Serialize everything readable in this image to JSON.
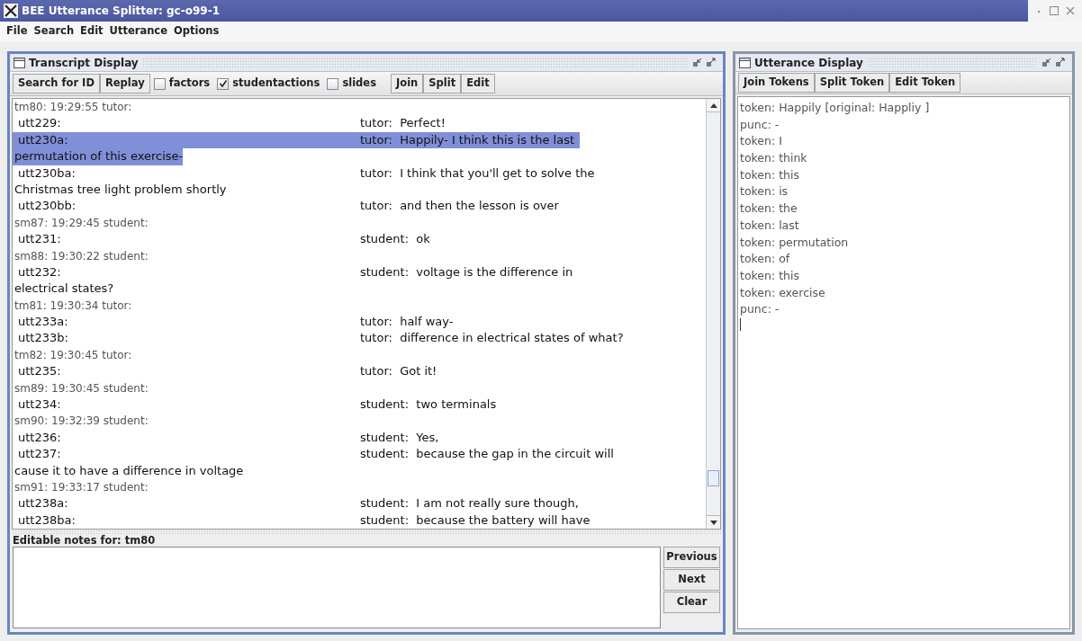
{
  "window": {
    "title": "BEE Utterance Splitter: gc-o99-1"
  },
  "menu": [
    "File",
    "Search",
    "Edit",
    "Utterance",
    "Options"
  ],
  "transcript_panel": {
    "title": "Transcript Display",
    "toolbar": [
      {
        "kind": "button",
        "label": "Search for ID"
      },
      {
        "kind": "button",
        "label": "Replay"
      },
      {
        "kind": "checkbox",
        "label": "factors",
        "checked": false
      },
      {
        "kind": "checkbox",
        "label": "studentactions",
        "checked": true
      },
      {
        "kind": "checkbox",
        "label": "slides",
        "checked": false
      },
      {
        "kind": "gap"
      },
      {
        "kind": "button",
        "label": "Join"
      },
      {
        "kind": "button",
        "label": "Split"
      },
      {
        "kind": "button",
        "label": "Edit"
      }
    ],
    "lines": [
      {
        "kind": "header",
        "text": "tm80: 19:29:55 tutor:"
      },
      {
        "kind": "utterance",
        "id": "utt229:",
        "text": "tutor:  Perfect!",
        "selected": false
      },
      {
        "kind": "utterance",
        "id": "utt230a:",
        "text": "tutor:  Happily- I think this is the last",
        "continuation": "permutation of this exercise-",
        "selected": true
      },
      {
        "kind": "utterance",
        "id": "utt230ba:",
        "text": "tutor:  I think that you'll get to solve the",
        "continuation": "Christmas tree light problem shortly",
        "selected": false
      },
      {
        "kind": "utterance",
        "id": "utt230bb:",
        "text": "tutor:  and then the lesson is over",
        "selected": false
      },
      {
        "kind": "header",
        "text": "sm87: 19:29:45 student:"
      },
      {
        "kind": "utterance",
        "id": "utt231:",
        "text": "student:  ok",
        "selected": false
      },
      {
        "kind": "header",
        "text": "sm88: 19:30:22 student:"
      },
      {
        "kind": "utterance",
        "id": "utt232:",
        "text": "student:  voltage is the difference in",
        "continuation": "electrical states?",
        "selected": false
      },
      {
        "kind": "header",
        "text": "tm81: 19:30:34 tutor:"
      },
      {
        "kind": "utterance",
        "id": "utt233a:",
        "text": "tutor:  half way-",
        "selected": false
      },
      {
        "kind": "utterance",
        "id": "utt233b:",
        "text": "tutor:  difference in electrical states of what?",
        "selected": false
      },
      {
        "kind": "header",
        "text": "tm82: 19:30:45 tutor:"
      },
      {
        "kind": "utterance",
        "id": "utt235:",
        "text": "tutor:  Got it!",
        "selected": false
      },
      {
        "kind": "header",
        "text": "sm89: 19:30:45 student:"
      },
      {
        "kind": "utterance",
        "id": "utt234:",
        "text": "student:  two terminals",
        "selected": false
      },
      {
        "kind": "header",
        "text": "sm90: 19:32:39 student:"
      },
      {
        "kind": "utterance",
        "id": "utt236:",
        "text": "student:  Yes,",
        "selected": false
      },
      {
        "kind": "utterance",
        "id": "utt237:",
        "text": "student:  because the gap in the circuit will",
        "continuation": "cause it to have a difference in voltage",
        "selected": false
      },
      {
        "kind": "header",
        "text": "sm91: 19:33:17 student:"
      },
      {
        "kind": "utterance",
        "id": "utt238a:",
        "text": "student:  I am not really sure though,",
        "selected": false
      },
      {
        "kind": "utterance",
        "id": "utt238ba:",
        "text": "student:  because the battery will have",
        "selected": false
      }
    ],
    "notes": {
      "label": "Editable notes for: tm80",
      "buttons": [
        "Previous",
        "Next",
        "Clear"
      ]
    }
  },
  "utterance_panel": {
    "title": "Utterance Display",
    "buttons": [
      "Join Tokens",
      "Split Token",
      "Edit Token"
    ],
    "lines": [
      "token: Happily [original: Happliy ]",
      "punc: -",
      "token: I",
      "token: think",
      "token: this",
      "token: is",
      "token: the",
      "token: last",
      "token: permutation",
      "token: of",
      "token: this",
      "token: exercise",
      "punc: -"
    ]
  }
}
